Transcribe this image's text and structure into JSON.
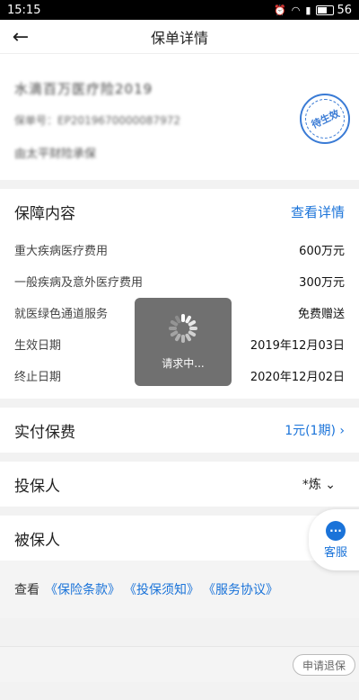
{
  "status_bar": {
    "time": "15:15",
    "battery": "56"
  },
  "nav": {
    "title": "保单详情"
  },
  "policy": {
    "name": "水滴百万医疗险2019",
    "number": "保单号：EP2019670000087972",
    "insurer": "由太平财险承保",
    "stamp": "待生效"
  },
  "coverage": {
    "title": "保障内容",
    "detail_link": "查看详情",
    "items": [
      {
        "label": "重大疾病医疗费用",
        "value": "600万元"
      },
      {
        "label": "一般疾病及意外医疗费用",
        "value": "300万元"
      },
      {
        "label": "就医绿色通道服务",
        "value": "免费赠送"
      },
      {
        "label": "生效日期",
        "value": "2019年12月03日"
      },
      {
        "label": "终止日期",
        "value": "2020年12月02日"
      }
    ]
  },
  "premium": {
    "label": "实付保费",
    "value": "1元(1期)"
  },
  "policyholder": {
    "label": "投保人",
    "value": "*炼"
  },
  "insured": {
    "label": "被保人"
  },
  "terms": {
    "prefix": "查看",
    "links": [
      "《保险条款》",
      "《投保须知》",
      "《服务协议》"
    ]
  },
  "refund_button": "申请退保",
  "customer_service": "客服",
  "loading": {
    "text": "请求中..."
  }
}
